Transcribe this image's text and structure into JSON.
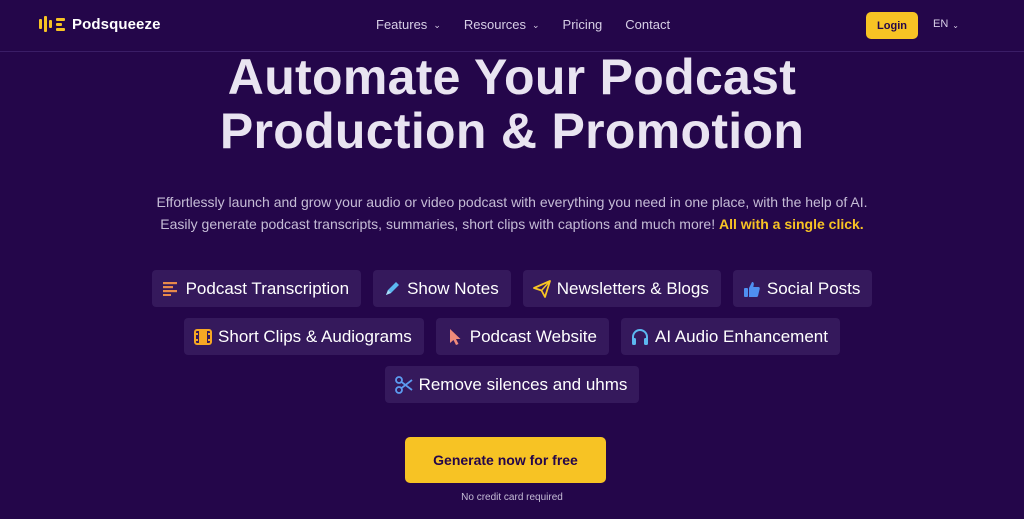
{
  "nav": {
    "brand": "Podsqueeze",
    "links": [
      {
        "label": "Features",
        "dropdown": true
      },
      {
        "label": "Resources",
        "dropdown": true
      },
      {
        "label": "Pricing",
        "dropdown": false
      },
      {
        "label": "Contact",
        "dropdown": false
      }
    ],
    "login_label": "Login",
    "language": "EN"
  },
  "hero": {
    "title_line1": "Automate Your Podcast",
    "title_line2": "Production & Promotion",
    "subtitle_line1": "Effortlessly launch and grow your audio or video podcast with everything you need in one place, with the help of AI.",
    "subtitle_line2_prefix": "Easily generate podcast transcripts, summaries, short clips with captions and much more! ",
    "subtitle_highlight": "All with a single click."
  },
  "features": [
    {
      "label": "Podcast Transcription",
      "icon": "text-lines-icon"
    },
    {
      "label": "Show Notes",
      "icon": "pen-icon"
    },
    {
      "label": "Newsletters & Blogs",
      "icon": "paper-plane-icon"
    },
    {
      "label": "Social Posts",
      "icon": "thumbs-up-icon"
    },
    {
      "label": "Short Clips & Audiograms",
      "icon": "film-icon"
    },
    {
      "label": "Podcast Website",
      "icon": "cursor-pointer-icon"
    },
    {
      "label": "AI Audio Enhancement",
      "icon": "headphones-icon"
    },
    {
      "label": "Remove silences and uhms",
      "icon": "scissors-icon"
    }
  ],
  "cta": {
    "label": "Generate now for free",
    "note": "No credit card required"
  },
  "colors": {
    "background": "#24064a",
    "accent": "#f7c324",
    "chip_bg": "#35195c"
  }
}
